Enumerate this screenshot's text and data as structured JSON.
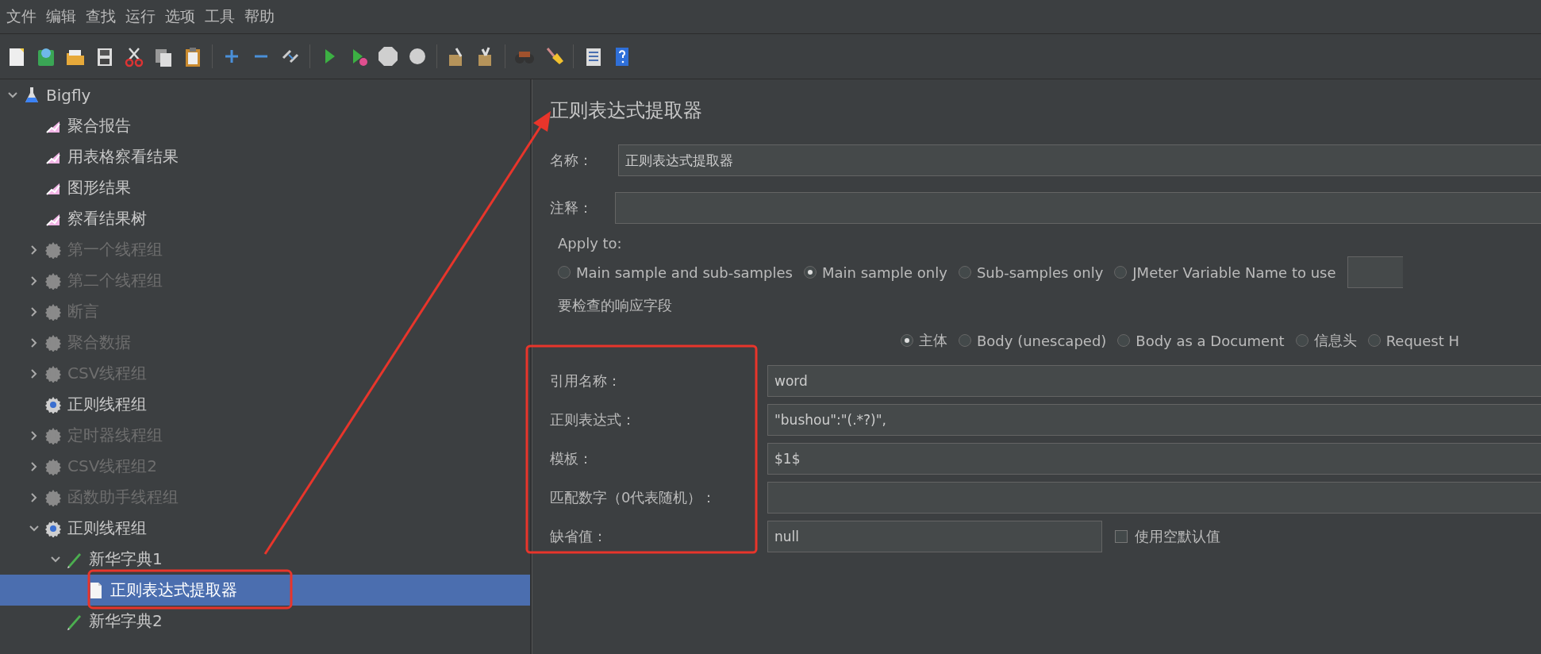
{
  "menu": [
    "文件",
    "编辑",
    "查找",
    "运行",
    "选项",
    "工具",
    "帮助"
  ],
  "tree": [
    {
      "label": "Bigfly",
      "kind": "test-plan",
      "disabled": false,
      "selected": false,
      "expanded": true,
      "children": [
        {
          "label": "聚合报告",
          "kind": "listener",
          "disabled": false,
          "selected": false
        },
        {
          "label": "用表格察看结果",
          "kind": "listener",
          "disabled": false,
          "selected": false
        },
        {
          "label": "图形结果",
          "kind": "listener",
          "disabled": false,
          "selected": false
        },
        {
          "label": "察看结果树",
          "kind": "listener",
          "disabled": false,
          "selected": false
        },
        {
          "label": "第一个线程组",
          "kind": "thread-group",
          "disabled": true,
          "selected": false,
          "expanded": false
        },
        {
          "label": "第二个线程组",
          "kind": "thread-group",
          "disabled": true,
          "selected": false,
          "expanded": false
        },
        {
          "label": "断言",
          "kind": "thread-group",
          "disabled": true,
          "selected": false,
          "expanded": false
        },
        {
          "label": "聚合数据",
          "kind": "thread-group",
          "disabled": true,
          "selected": false,
          "expanded": false
        },
        {
          "label": "CSV线程组",
          "kind": "thread-group",
          "disabled": true,
          "selected": false,
          "expanded": false
        },
        {
          "label": "正则线程组",
          "kind": "thread-group",
          "disabled": false,
          "selected": false
        },
        {
          "label": "定时器线程组",
          "kind": "thread-group",
          "disabled": true,
          "selected": false,
          "expanded": false
        },
        {
          "label": "CSV线程组2",
          "kind": "thread-group",
          "disabled": true,
          "selected": false,
          "expanded": false
        },
        {
          "label": "函数助手线程组",
          "kind": "thread-group",
          "disabled": true,
          "selected": false,
          "expanded": false
        },
        {
          "label": "正则线程组",
          "kind": "thread-group",
          "disabled": false,
          "selected": false,
          "expanded": true,
          "children": [
            {
              "label": "新华字典1",
              "kind": "sampler",
              "disabled": false,
              "selected": false,
              "expanded": true,
              "children": [
                {
                  "label": "正则表达式提取器",
                  "kind": "extractor",
                  "disabled": false,
                  "selected": true
                }
              ]
            },
            {
              "label": "新华字典2",
              "kind": "sampler",
              "disabled": false,
              "selected": false
            }
          ]
        }
      ]
    }
  ],
  "panel": {
    "title": "正则表达式提取器",
    "name": {
      "label": "名称：",
      "value": "正则表达式提取器"
    },
    "comment": {
      "label": "注释："
    },
    "apply_to": {
      "label": "Apply to:",
      "options": [
        {
          "label": "Main sample and sub-samples",
          "selected": false
        },
        {
          "label": "Main sample only",
          "selected": true
        },
        {
          "label": "Sub-samples only",
          "selected": false
        },
        {
          "label": "JMeter Variable Name to use",
          "selected": false
        }
      ]
    },
    "field_to_check": {
      "label": "要检查的响应字段",
      "options": [
        {
          "label": "主体",
          "selected": true
        },
        {
          "label": "Body (unescaped)",
          "selected": false
        },
        {
          "label": "Body as a Document",
          "selected": false
        },
        {
          "label": "信息头",
          "selected": false
        },
        {
          "label": "Request H",
          "selected": false
        }
      ]
    },
    "fields": [
      {
        "label": "引用名称：",
        "value": "word"
      },
      {
        "label": "正则表达式：",
        "value": "\"bushou\":\"(.*?)\","
      },
      {
        "label": "模板：",
        "value": "$1$"
      },
      {
        "label": "匹配数字（0代表随机）："
      },
      {
        "label": "缺省值：",
        "value": "null",
        "kind": "default",
        "checkbox": {
          "label": "使用空默认值",
          "checked": false
        }
      }
    ]
  }
}
